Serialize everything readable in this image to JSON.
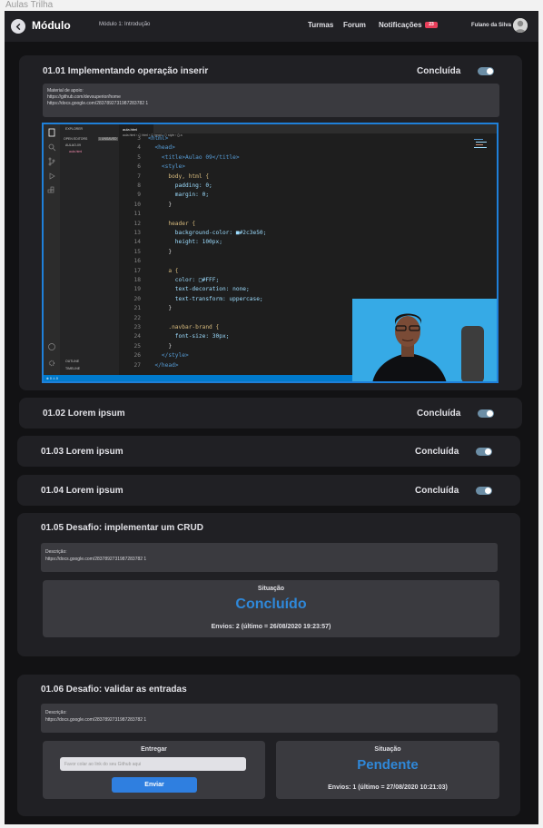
{
  "window_title": "Aulas Trilha",
  "header": {
    "brand": "Módulo",
    "breadcrumb": "Módulo 1: Introdução",
    "nav": {
      "turmas": "Turmas",
      "forum": "Forum",
      "notifications": "Notificações",
      "notification_count": "23"
    },
    "user_name": "Fulano da Silva"
  },
  "lessons": [
    {
      "title": "01.01 Implementando operação inserir",
      "status": "Concluída",
      "completed": true,
      "support_label": "Material de apoio:",
      "links": [
        "https://github.com/devsuperior/home",
        "https://docs.google.com/2837892731987283782 1"
      ]
    },
    {
      "title": "01.02 Lorem ipsum",
      "status": "Concluída",
      "completed": true
    },
    {
      "title": "01.03 Lorem ipsum",
      "status": "Concluída",
      "completed": true
    },
    {
      "title": "01.04 Lorem ipsum",
      "status": "Concluída",
      "completed": true
    }
  ],
  "video": {
    "tab": "aula.html",
    "explorer": "EXPLORER",
    "open_editors": "OPEN EDITORS",
    "unsaved": "1 UNSAVED",
    "folder": "AULAO-09",
    "file": "aula.html",
    "breadcrumb": "aula.html › ⬡ html › ⬡ head › ⬡ style › {} a",
    "outline": "OUTLINE",
    "timeline": "TIMELINE",
    "status_bar": "⊗ 0 ⚠ 0",
    "code_lines": [
      {
        "n": "3",
        "t": "<html>"
      },
      {
        "n": "4",
        "t": "  <head>"
      },
      {
        "n": "5",
        "t": "    <title>Aulao 09</title>"
      },
      {
        "n": "6",
        "t": "    <style>"
      },
      {
        "n": "7",
        "t": "      body, html {"
      },
      {
        "n": "8",
        "t": "        padding: 0;"
      },
      {
        "n": "9",
        "t": "        margin: 0;"
      },
      {
        "n": "10",
        "t": "      }"
      },
      {
        "n": "11",
        "t": ""
      },
      {
        "n": "12",
        "t": "      header {"
      },
      {
        "n": "13",
        "t": "        background-color: ■#2c3e50;"
      },
      {
        "n": "14",
        "t": "        height: 100px;"
      },
      {
        "n": "15",
        "t": "      }"
      },
      {
        "n": "16",
        "t": ""
      },
      {
        "n": "17",
        "t": "      a {"
      },
      {
        "n": "18",
        "t": "        color: □#FFF;"
      },
      {
        "n": "19",
        "t": "        text-decoration: none;"
      },
      {
        "n": "20",
        "t": "        text-transform: uppercase;"
      },
      {
        "n": "21",
        "t": "      }"
      },
      {
        "n": "22",
        "t": ""
      },
      {
        "n": "23",
        "t": "      .navbar-brand {"
      },
      {
        "n": "24",
        "t": "        font-size: 30px;"
      },
      {
        "n": "25",
        "t": "      }"
      },
      {
        "n": "26",
        "t": "    </style>"
      },
      {
        "n": "27",
        "t": "  </head>"
      }
    ]
  },
  "challenges": [
    {
      "title": "01.05 Desafio: implementar um CRUD",
      "description_label": "Descrição:",
      "description_link": "https://docs.google.com/2837892731987283782 1",
      "situation_label": "Situação",
      "situation_value": "Concluído",
      "sends": "Envios: 2 (último = 26/08/2020 19:23:57)"
    },
    {
      "title": "01.06 Desafio: validar as entradas",
      "description_label": "Descrição:",
      "description_link": "https://docs.google.com/2837892731987283782 1",
      "deliver_label": "Entregar",
      "deliver_placeholder": "Favor colar ao link do seu Github aqui",
      "send_button": "Enviar",
      "situation_label": "Situação",
      "situation_value": "Pendente",
      "sends": "Envios: 1 (último = 27/08/2020 10:21:03)"
    }
  ],
  "colors": {
    "accent": "#2f88d9",
    "badge": "#e83f5b",
    "card": "#202024",
    "toggle": "#6c8ea6"
  }
}
